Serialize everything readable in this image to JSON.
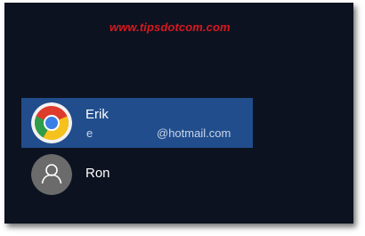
{
  "watermark": "www.tipsdotcom.com",
  "users": [
    {
      "name": "Erik",
      "email_prefix": "e",
      "email_domain": "@hotmail.com",
      "avatar_icon": "chrome-logo-icon",
      "selected": true
    },
    {
      "name": "Ron",
      "avatar_icon": "default-user-icon",
      "selected": false
    }
  ],
  "colors": {
    "background": "#0c1220",
    "selected_row": "#214d8c",
    "watermark": "#d8181e",
    "text": "#ffffff"
  }
}
